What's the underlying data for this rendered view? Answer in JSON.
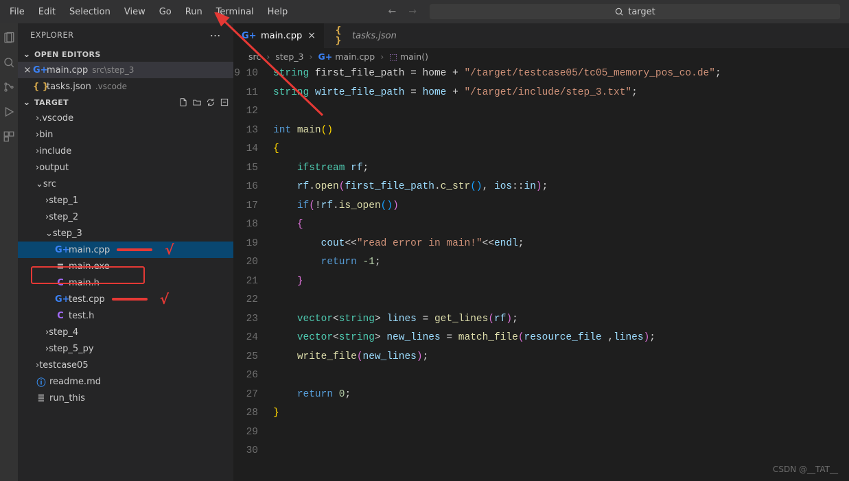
{
  "menu": [
    "File",
    "Edit",
    "Selection",
    "View",
    "Go",
    "Run",
    "Terminal",
    "Help"
  ],
  "search_value": "target",
  "sidebar_title": "EXPLORER",
  "open_editors_label": "OPEN EDITORS",
  "open_editors": [
    {
      "name": "main.cpp",
      "path": "src\\step_3",
      "icon": "cpp",
      "active": true,
      "closable": true
    },
    {
      "name": "tasks.json",
      "path": ".vscode",
      "icon": "json",
      "active": false,
      "closable": false
    }
  ],
  "workspace_label": "TARGET",
  "tree": [
    {
      "type": "folder",
      "name": ".vscode",
      "level": 1,
      "expanded": false
    },
    {
      "type": "folder",
      "name": "bin",
      "level": 1,
      "expanded": false
    },
    {
      "type": "folder",
      "name": "include",
      "level": 1,
      "expanded": false
    },
    {
      "type": "folder",
      "name": "output",
      "level": 1,
      "expanded": false
    },
    {
      "type": "folder",
      "name": "src",
      "level": 1,
      "expanded": true
    },
    {
      "type": "folder",
      "name": "step_1",
      "level": 2,
      "expanded": false
    },
    {
      "type": "folder",
      "name": "step_2",
      "level": 2,
      "expanded": false
    },
    {
      "type": "folder",
      "name": "step_3",
      "level": 2,
      "expanded": true,
      "highlight": true
    },
    {
      "type": "file",
      "name": "main.cpp",
      "level": 3,
      "icon": "cpp",
      "selected": true,
      "mark": "line-check"
    },
    {
      "type": "file",
      "name": "main.exe",
      "level": 3,
      "icon": "exe"
    },
    {
      "type": "file",
      "name": "main.h",
      "level": 3,
      "icon": "c"
    },
    {
      "type": "file",
      "name": "test.cpp",
      "level": 3,
      "icon": "cpp",
      "mark": "line-check"
    },
    {
      "type": "file",
      "name": "test.h",
      "level": 3,
      "icon": "c"
    },
    {
      "type": "folder",
      "name": "step_4",
      "level": 2,
      "expanded": false
    },
    {
      "type": "folder",
      "name": "step_5_py",
      "level": 2,
      "expanded": false
    },
    {
      "type": "folder",
      "name": "testcase05",
      "level": 1,
      "expanded": false
    },
    {
      "type": "file",
      "name": "readme.md",
      "level": 1,
      "icon": "info"
    },
    {
      "type": "file",
      "name": "run_this",
      "level": 1,
      "icon": "hash"
    }
  ],
  "tabs": [
    {
      "name": "main.cpp",
      "icon": "cpp",
      "active": true,
      "closable": true
    },
    {
      "name": "tasks.json",
      "icon": "json",
      "active": false,
      "closable": false
    }
  ],
  "breadcrumbs": [
    "src",
    "step_3",
    "main.cpp",
    "main()"
  ],
  "code": {
    "first_line_no": 9,
    "lines": [
      [
        [
          "type",
          "string"
        ],
        [
          "text",
          " first_file_path = home + "
        ],
        [
          "str",
          "\"/target/testcase05/tc05_memory_pos_co.de\""
        ],
        [
          "pun",
          ";"
        ]
      ],
      [
        [
          "type",
          "string"
        ],
        [
          "text",
          " "
        ],
        [
          "var",
          "wirte_file_path"
        ],
        [
          "text",
          " = "
        ],
        [
          "var",
          "home"
        ],
        [
          "text",
          " + "
        ],
        [
          "str",
          "\"/target/include/step_3.txt\""
        ],
        [
          "pun",
          ";"
        ]
      ],
      [],
      [
        [
          "key",
          "int"
        ],
        [
          "text",
          " "
        ],
        [
          "func",
          "main"
        ],
        [
          "brcY",
          "("
        ],
        [
          "brcY",
          ")"
        ]
      ],
      [
        [
          "brcY",
          "{"
        ]
      ],
      [
        [
          "pad",
          "    "
        ],
        [
          "type",
          "ifstream"
        ],
        [
          "text",
          " "
        ],
        [
          "var",
          "rf"
        ],
        [
          "pun",
          ";"
        ]
      ],
      [
        [
          "pad",
          "    "
        ],
        [
          "var",
          "rf"
        ],
        [
          "pun",
          "."
        ],
        [
          "func",
          "open"
        ],
        [
          "brc",
          "("
        ],
        [
          "var",
          "first_file_path"
        ],
        [
          "pun",
          "."
        ],
        [
          "func",
          "c_str"
        ],
        [
          "brc2",
          "("
        ],
        [
          "brc2",
          ")"
        ],
        [
          "pun",
          ", "
        ],
        [
          "var",
          "ios"
        ],
        [
          "pun",
          "::"
        ],
        [
          "var",
          "in"
        ],
        [
          "brc",
          ")"
        ],
        [
          "pun",
          ";"
        ]
      ],
      [
        [
          "pad",
          "    "
        ],
        [
          "key",
          "if"
        ],
        [
          "brc",
          "("
        ],
        [
          "pun",
          "!"
        ],
        [
          "var",
          "rf"
        ],
        [
          "pun",
          "."
        ],
        [
          "func",
          "is_open"
        ],
        [
          "brc2",
          "("
        ],
        [
          "brc2",
          ")"
        ],
        [
          "brc",
          ")"
        ]
      ],
      [
        [
          "pad",
          "    "
        ],
        [
          "brc",
          "{"
        ]
      ],
      [
        [
          "pad",
          "        "
        ],
        [
          "var",
          "cout"
        ],
        [
          "pun",
          "<<"
        ],
        [
          "str",
          "\"read error in main!\""
        ],
        [
          "pun",
          "<<"
        ],
        [
          "var",
          "endl"
        ],
        [
          "pun",
          ";"
        ]
      ],
      [
        [
          "pad",
          "        "
        ],
        [
          "key",
          "return"
        ],
        [
          "text",
          " "
        ],
        [
          "num",
          "-1"
        ],
        [
          "pun",
          ";"
        ]
      ],
      [
        [
          "pad",
          "    "
        ],
        [
          "brc",
          "}"
        ]
      ],
      [],
      [
        [
          "pad",
          "    "
        ],
        [
          "type",
          "vector"
        ],
        [
          "pun",
          "<"
        ],
        [
          "type",
          "string"
        ],
        [
          "pun",
          ">"
        ],
        [
          "text",
          " "
        ],
        [
          "var",
          "lines"
        ],
        [
          "text",
          " = "
        ],
        [
          "func",
          "get_lines"
        ],
        [
          "brc",
          "("
        ],
        [
          "var",
          "rf"
        ],
        [
          "brc",
          ")"
        ],
        [
          "pun",
          ";"
        ]
      ],
      [
        [
          "pad",
          "    "
        ],
        [
          "type",
          "vector"
        ],
        [
          "pun",
          "<"
        ],
        [
          "type",
          "string"
        ],
        [
          "pun",
          ">"
        ],
        [
          "text",
          " "
        ],
        [
          "var",
          "new_lines"
        ],
        [
          "text",
          " = "
        ],
        [
          "func",
          "match_file"
        ],
        [
          "brc",
          "("
        ],
        [
          "var",
          "resource_file"
        ],
        [
          "pun",
          " ,"
        ],
        [
          "var",
          "lines"
        ],
        [
          "brc",
          ")"
        ],
        [
          "pun",
          ";"
        ]
      ],
      [
        [
          "pad",
          "    "
        ],
        [
          "func",
          "write_file"
        ],
        [
          "brc",
          "("
        ],
        [
          "var",
          "new_lines"
        ],
        [
          "brc",
          ")"
        ],
        [
          "pun",
          ";"
        ]
      ],
      [],
      [
        [
          "pad",
          "    "
        ],
        [
          "key",
          "return"
        ],
        [
          "text",
          " "
        ],
        [
          "num",
          "0"
        ],
        [
          "pun",
          ";"
        ]
      ],
      [
        [
          "brcY",
          "}"
        ]
      ],
      [],
      [],
      []
    ]
  },
  "watermark": "CSDN @__TAT__"
}
